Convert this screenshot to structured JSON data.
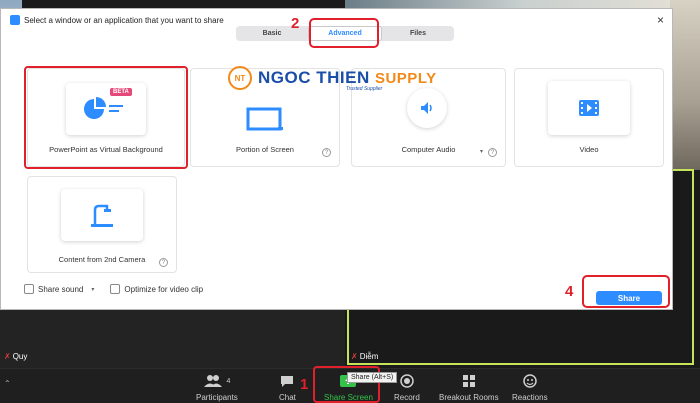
{
  "dialog": {
    "title": "Select a window or an application that you want to share",
    "close_icon": "×",
    "tabs": [
      {
        "label": "Basic",
        "active": false
      },
      {
        "label": "Advanced",
        "active": true
      },
      {
        "label": "Files",
        "active": false
      }
    ],
    "options": [
      {
        "label": "PowerPoint as Virtual Background",
        "badge": "BETA",
        "icon": "powerpoint-icon"
      },
      {
        "label": "Portion of Screen",
        "icon": "screen-portion-icon"
      },
      {
        "label": "Computer Audio",
        "icon": "speaker-icon"
      },
      {
        "label": "Video",
        "icon": "video-file-icon"
      },
      {
        "label": "Content from 2nd Camera",
        "icon": "document-camera-icon"
      }
    ],
    "share_sound_label": "Share sound",
    "optimize_label": "Optimize for video clip",
    "share_button": "Share"
  },
  "watermark": {
    "logo": "NT",
    "name": "NGOC THIEN",
    "supply": "SUPPLY",
    "tagline": "Trusted Supplier"
  },
  "participants": {
    "left_name": "Quy",
    "right_name": "Diễm"
  },
  "toolbar": {
    "participants_label": "Participants",
    "participants_count": "4",
    "chat_label": "Chat",
    "share_screen_label": "Share Screen",
    "record_label": "Record",
    "breakout_label": "Breakout Rooms",
    "reactions_label": "Reactions",
    "tooltip": "Share (Alt+S)"
  },
  "steps": [
    "1",
    "2",
    "3",
    "4"
  ],
  "colors": {
    "accent": "#2d8cff",
    "annotation": "#e0202a",
    "active_speaker": "#c6e45a",
    "share_green": "#34c24a",
    "beta_badge": "#e6487a"
  }
}
